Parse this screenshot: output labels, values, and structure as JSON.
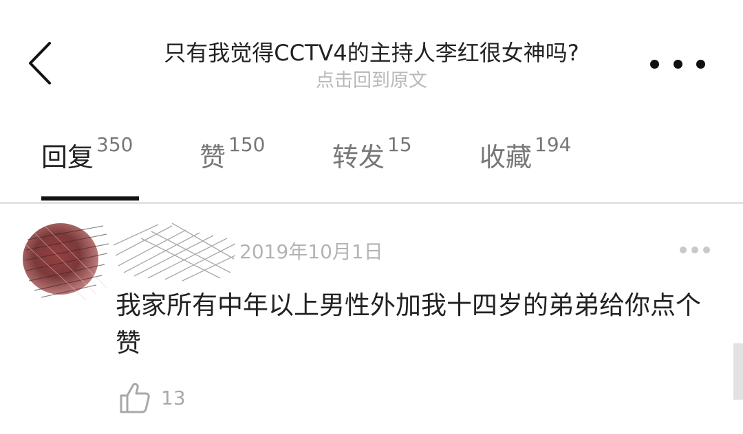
{
  "header": {
    "title": "只有我觉得CCTV4的主持人李红很女神吗?",
    "subtitle": "点击回到原文"
  },
  "tabs": [
    {
      "label": "回复",
      "count": "350"
    },
    {
      "label": "赞",
      "count": "150"
    },
    {
      "label": "转发",
      "count": "15"
    },
    {
      "label": "收藏",
      "count": "194"
    }
  ],
  "comment": {
    "date": "2019年10月1日",
    "text": "我家所有中年以上男性外加我十四岁的弟弟给你点个赞",
    "like_count": "13"
  }
}
